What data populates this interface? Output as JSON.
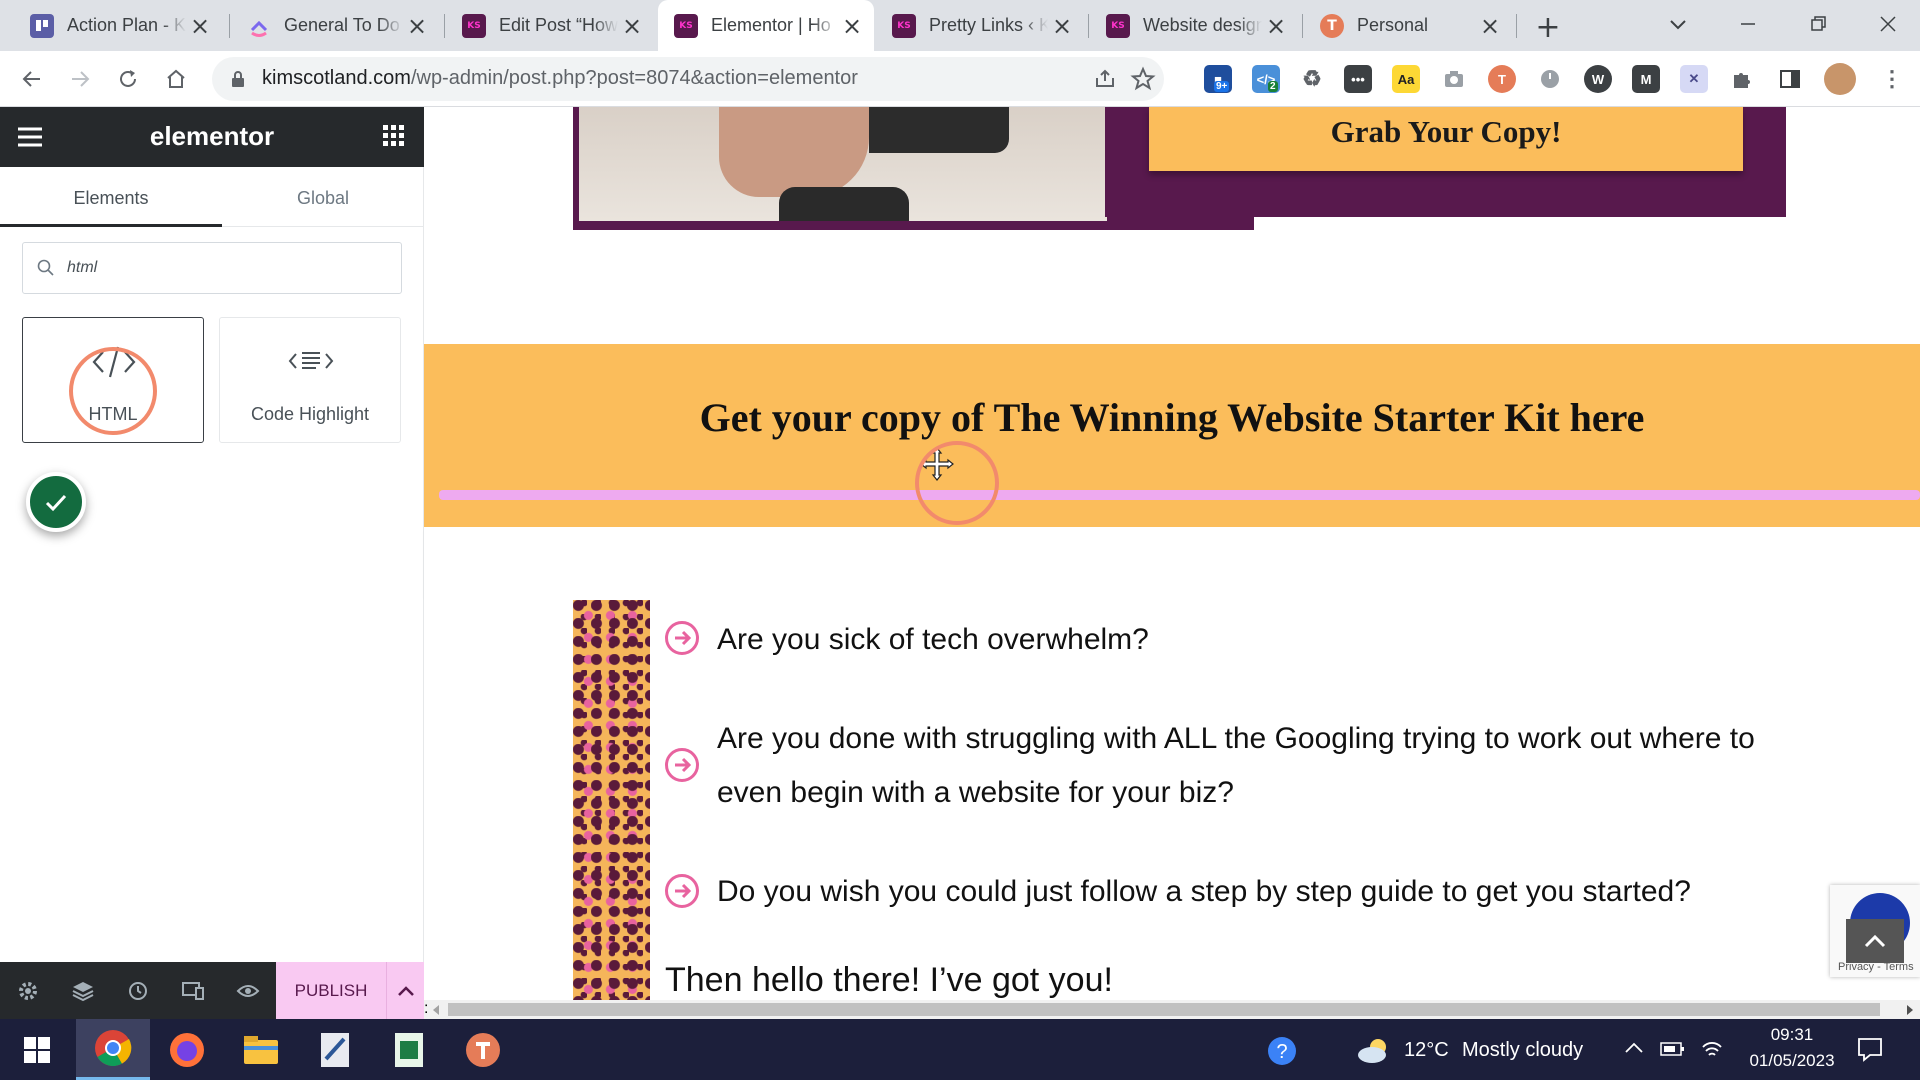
{
  "browser": {
    "tabs": [
      {
        "title": "Action Plan - K",
        "favicon": "trello-icon",
        "color": "#5b5ea6"
      },
      {
        "title": "General To Do",
        "favicon": "clickup-icon",
        "color": "#7b68ee"
      },
      {
        "title": "Edit Post “How",
        "favicon": "ks-icon",
        "color": "#58194d"
      },
      {
        "title": "Elementor | Ho",
        "favicon": "ks-icon",
        "color": "#58194d"
      },
      {
        "title": "Pretty Links ‹ K",
        "favicon": "ks-icon",
        "color": "#58194d"
      },
      {
        "title": "Website design",
        "favicon": "ks-icon",
        "color": "#58194d"
      },
      {
        "title": "Personal",
        "favicon": "toggl-icon",
        "color": "#e57c58"
      }
    ],
    "active_tab": 3,
    "url_host": "kimscotland.com",
    "url_path": "/wp-admin/post.php?post=8074&action=elementor",
    "ext_badges": {
      "first": "9+",
      "second": "2"
    }
  },
  "panel": {
    "logo": "elementor",
    "tabs": [
      "Elements",
      "Global"
    ],
    "search_value": "html",
    "widgets": [
      {
        "label": "HTML",
        "icon": "code-icon"
      },
      {
        "label": "Code Highlight",
        "icon": "code-highlight-icon"
      }
    ],
    "publish_label": "PUBLISH"
  },
  "page": {
    "cta_button": "Grab Your Copy!",
    "banner_heading": "Get your copy of The Winning Website Starter Kit here",
    "bullets": [
      "Are you sick of tech overwhelm?",
      "Are you done with struggling with ALL the Googling trying to work out where to",
      "even begin with a website for your biz?",
      "Do you wish you could just follow a step by step guide to get you started?"
    ],
    "closing": "Then hello there! I’ve got you!",
    "recaptcha_text": "Privacy - Terms"
  },
  "taskbar": {
    "weather_temp": "12°C",
    "weather_desc": "Mostly cloudy",
    "time": "09:31",
    "date": "01/05/2023"
  },
  "colors": {
    "banner": "#fbbd5b",
    "purple": "#58194d",
    "pink_line": "#eeaaf0",
    "bullet": "#e8639f"
  }
}
